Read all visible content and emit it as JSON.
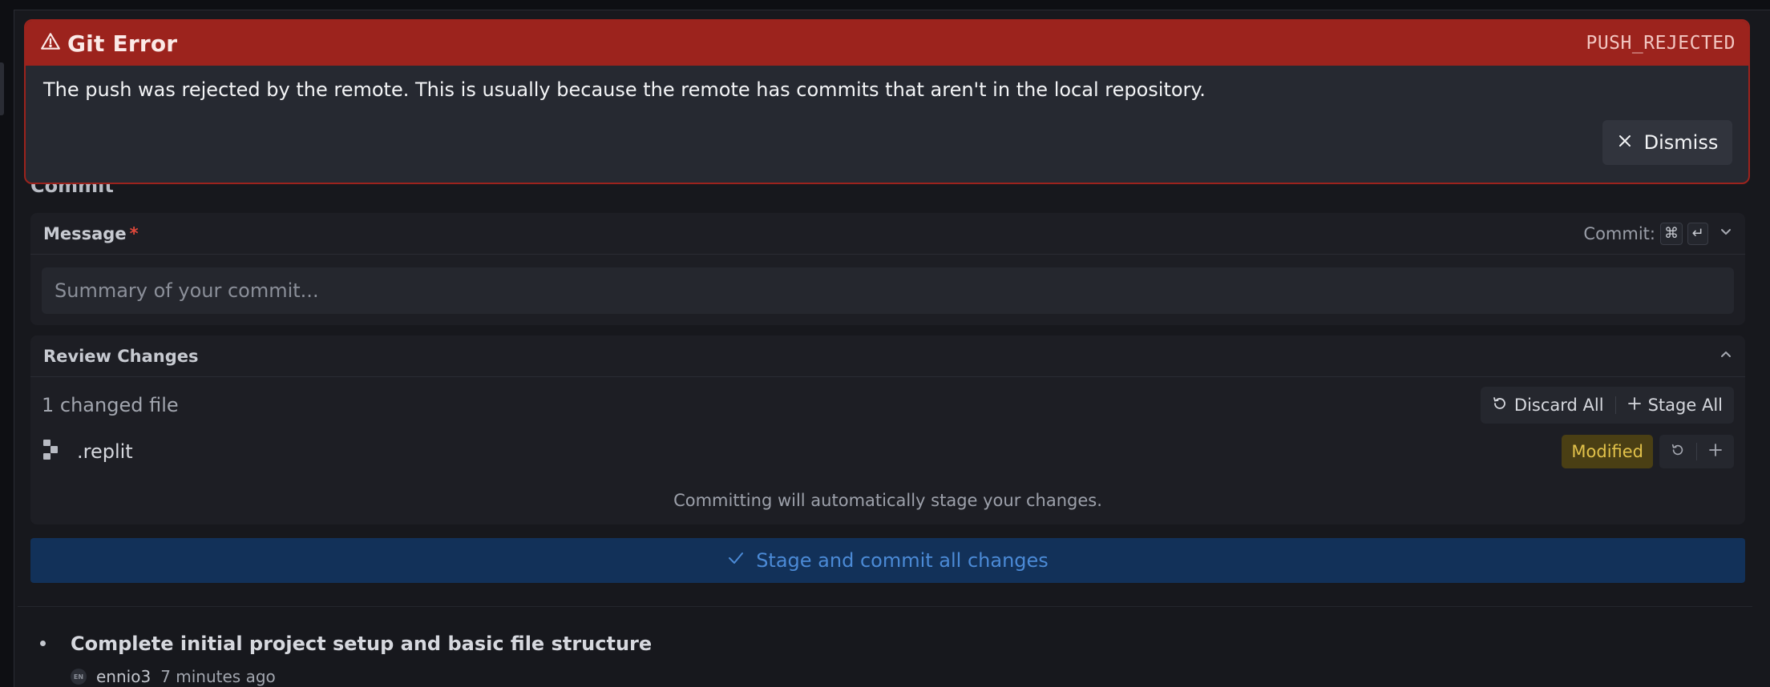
{
  "error": {
    "icon": "warning-triangle-icon",
    "title": "Git Error",
    "code": "PUSH_REJECTED",
    "message": "The push was rejected by the remote. This is usually because the remote has commits that aren't in the local repository.",
    "dismiss_label": "Dismiss",
    "header_color": "#9c231d"
  },
  "commit": {
    "section_title": "Commit",
    "message_label": "Message",
    "required_mark": "*",
    "shortcut_label": "Commit:",
    "shortcut_keys": [
      "⌘",
      "↵"
    ],
    "message_placeholder": "Summary of your commit...",
    "message_value": ""
  },
  "review": {
    "title": "Review Changes",
    "changed_count": "1 changed file",
    "discard_all_label": "Discard All",
    "stage_all_label": "Stage All",
    "files": [
      {
        "name": ".replit",
        "status": "Modified",
        "status_color": "#e2c24a"
      }
    ],
    "note": "Committing will automatically stage your changes."
  },
  "commit_button": {
    "label": "Stage and commit all changes",
    "color": "#123159"
  },
  "history": [
    {
      "title": "Complete initial project setup and basic file structure",
      "avatar_initials": "EN",
      "author": "ennio3",
      "time": "7 minutes ago"
    }
  ]
}
